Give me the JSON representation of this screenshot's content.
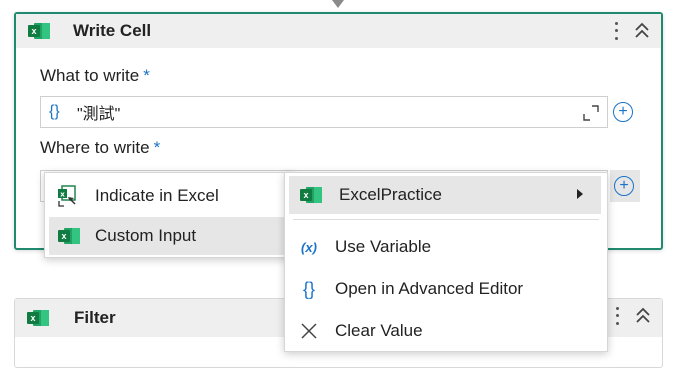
{
  "write_cell": {
    "title": "Write Cell",
    "what_label": "What to write",
    "required_mark": "*",
    "what_value": "\"測試\"",
    "where_label": "Where to write"
  },
  "filter_card": {
    "title": "Filter"
  },
  "left_menu": {
    "items": [
      {
        "label": "Indicate in Excel",
        "icon": "indicate-excel-icon"
      },
      {
        "label": "Custom Input",
        "icon": "excel-icon",
        "highlighted": true
      }
    ]
  },
  "right_menu": {
    "items": [
      {
        "label": "ExcelPractice",
        "icon": "excel-icon",
        "has_submenu": true
      },
      {
        "label": "Use Variable",
        "icon": "variable-icon"
      },
      {
        "label": "Open in Advanced Editor",
        "icon": "braces-icon"
      },
      {
        "label": "Clear Value",
        "icon": "close-icon"
      }
    ]
  },
  "icons": {
    "brace": "{}",
    "variable": "(x)",
    "plus": "+"
  },
  "colors": {
    "accent": "#1a73c8",
    "card_border_selected": "#1f8a6e",
    "excel_green": "#107c41",
    "hover_bg": "#e6e6e6"
  }
}
